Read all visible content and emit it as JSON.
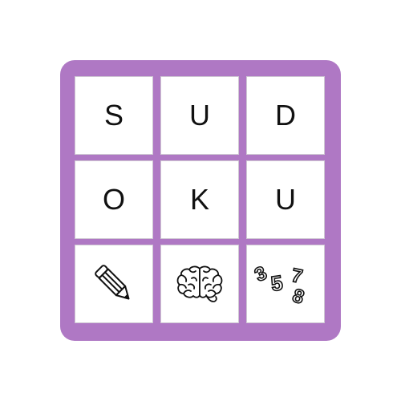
{
  "board": {
    "frame_color": "#af78c4",
    "cell_color": "#ffffff",
    "rows": [
      [
        {
          "type": "letter",
          "value": "S"
        },
        {
          "type": "letter",
          "value": "U"
        },
        {
          "type": "letter",
          "value": "D"
        }
      ],
      [
        {
          "type": "letter",
          "value": "O"
        },
        {
          "type": "letter",
          "value": "K"
        },
        {
          "type": "letter",
          "value": "U"
        }
      ],
      [
        {
          "type": "icon",
          "icon": "pencil-icon"
        },
        {
          "type": "icon",
          "icon": "brain-icon"
        },
        {
          "type": "icon",
          "icon": "numbers-icon",
          "digits": [
            "3",
            "5",
            "7",
            "8"
          ]
        }
      ]
    ]
  }
}
